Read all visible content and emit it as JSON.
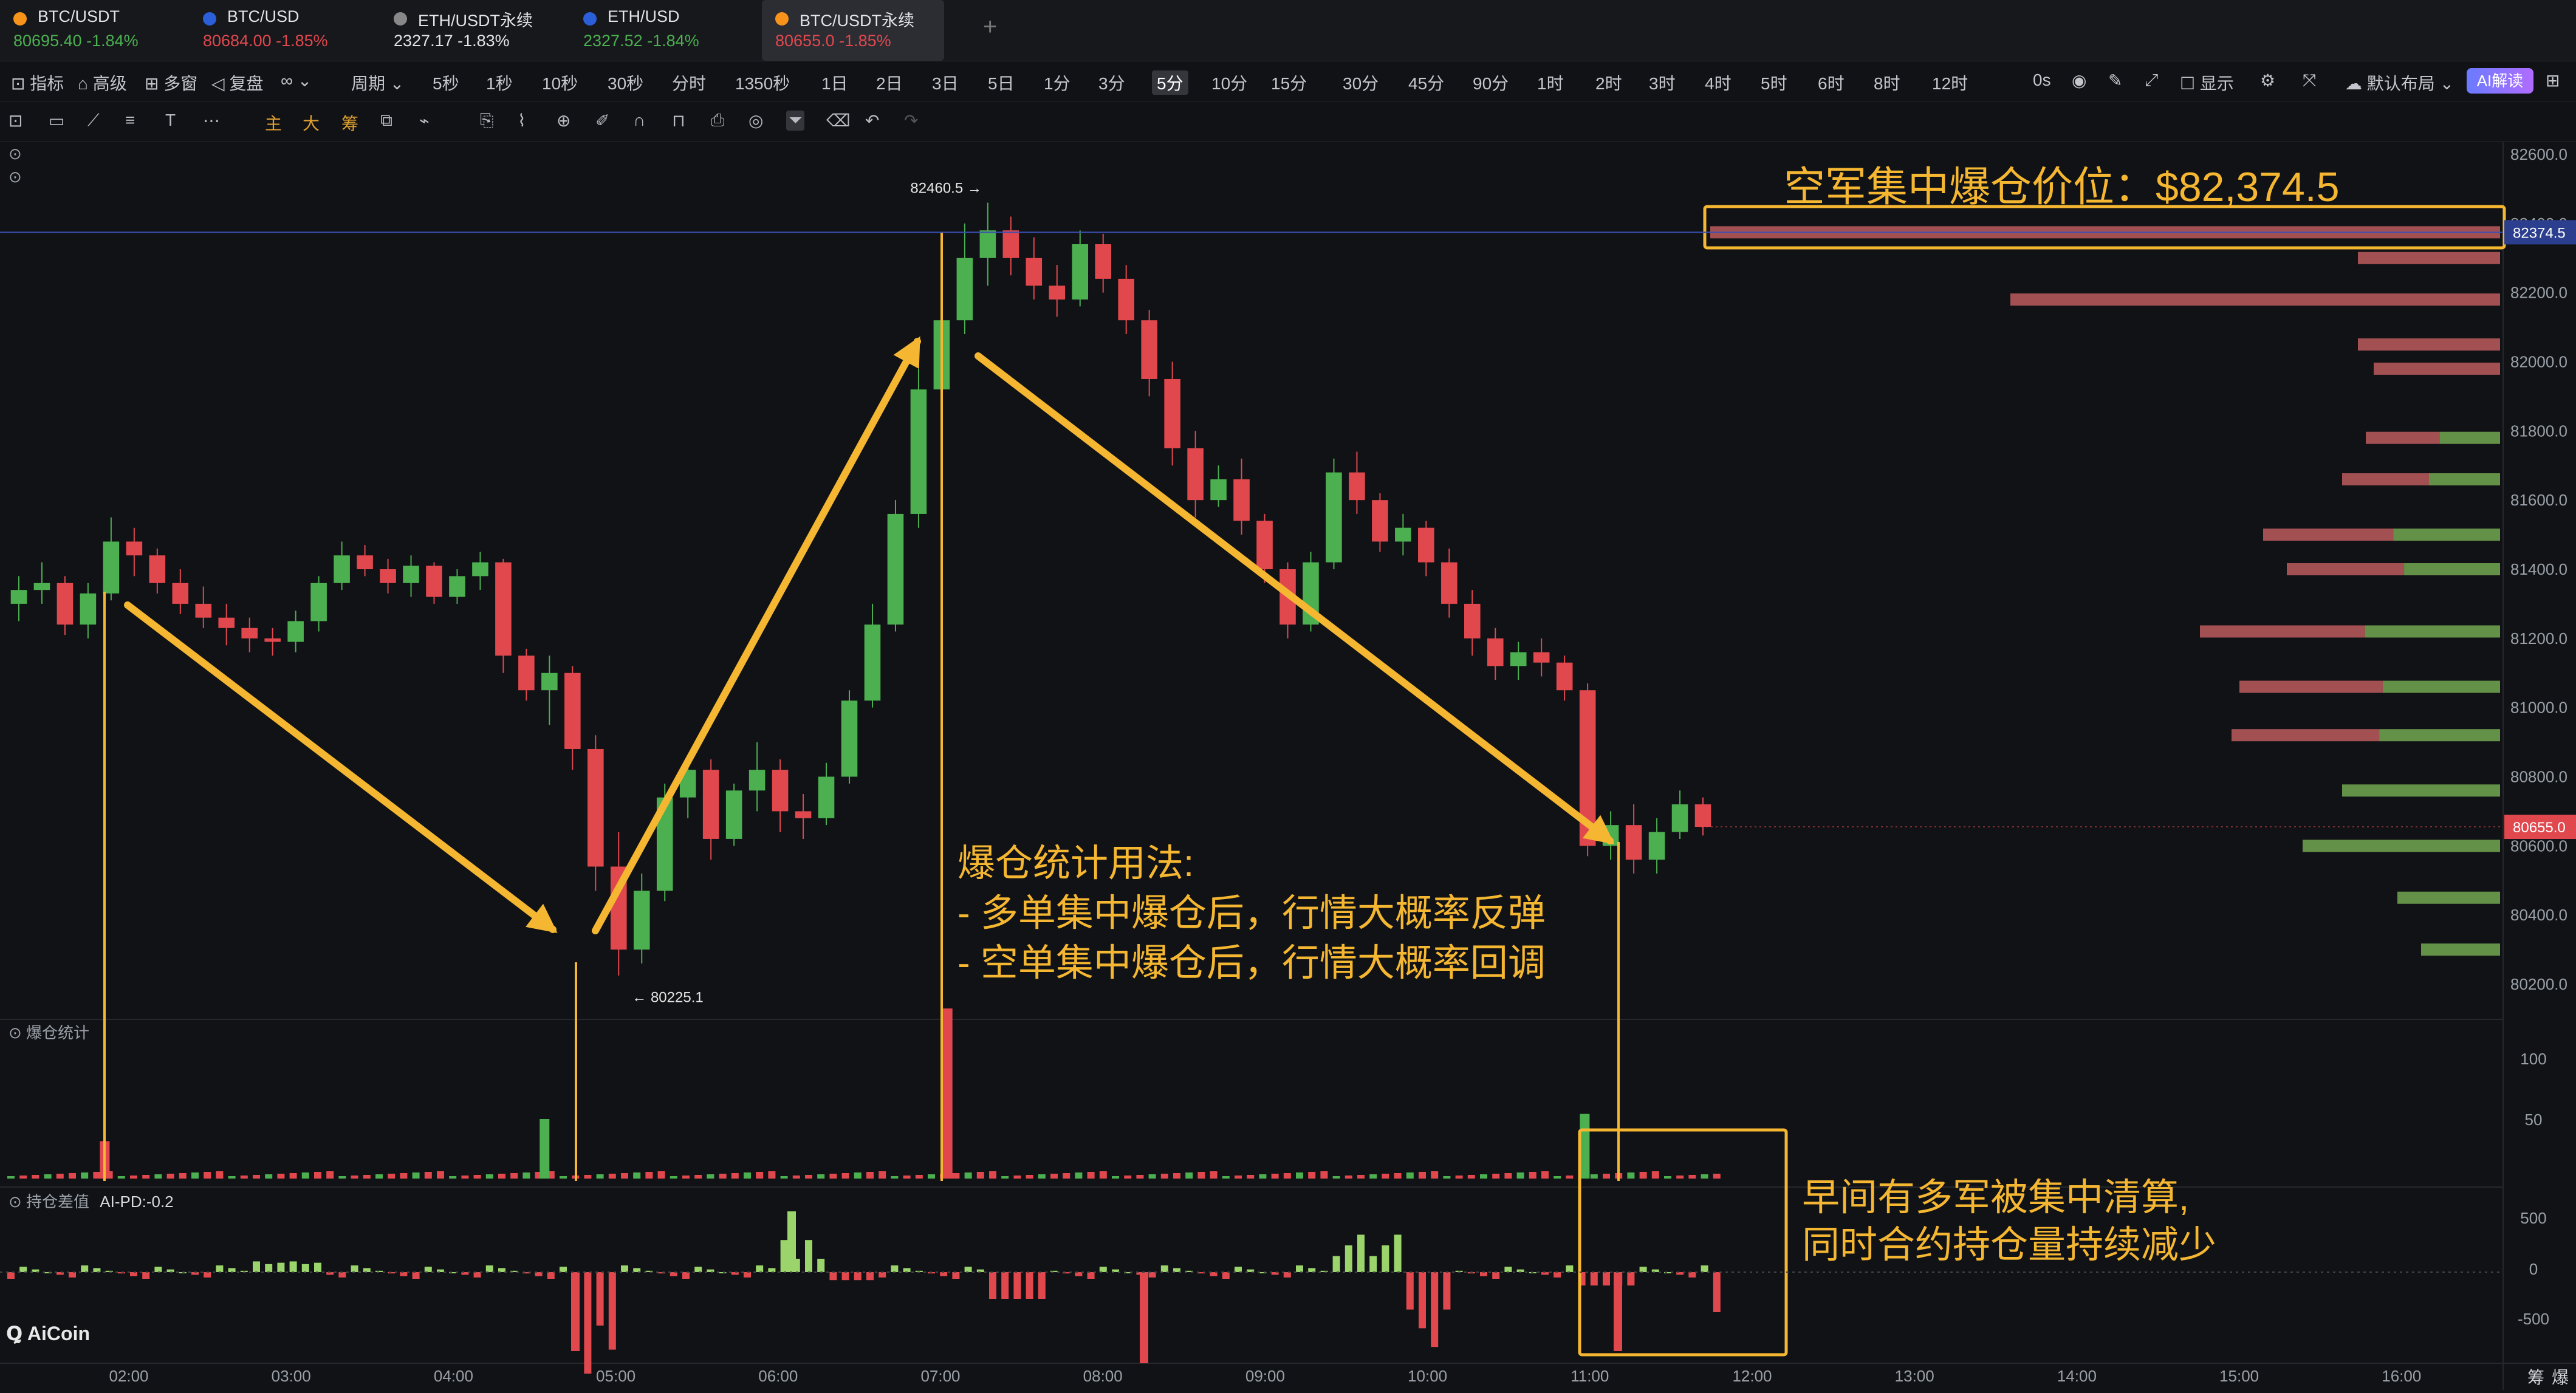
{
  "tabs": [
    {
      "name": "BTC/USDT",
      "price": "80695.40",
      "change": "-1.84%",
      "dot": "#f7931a",
      "color": "#4caf50"
    },
    {
      "name": "BTC/USD",
      "price": "80684.00",
      "change": "-1.85%",
      "dot": "#2b5fd9",
      "color": "#e0484e"
    },
    {
      "name": "ETH/USDT永续",
      "price": "2327.17",
      "change": "-1.83%",
      "dot": "#888888",
      "color": "#e2e4e8"
    },
    {
      "name": "ETH/USD",
      "price": "2327.52",
      "change": "-1.84%",
      "dot": "#2b5fd9",
      "color": "#4caf50"
    },
    {
      "name": "BTC/USDT永续",
      "price": "80655.0",
      "change": "-1.85%",
      "dot": "#f7931a",
      "color": "#e0484e"
    }
  ],
  "toolbar": {
    "indicator": "指标",
    "advanced": "高级",
    "multiwindow": "多窗",
    "replay": "复盘",
    "period": "周期",
    "intervals": [
      "5秒",
      "1秒",
      "10秒",
      "30秒",
      "分时",
      "1350秒",
      "1日",
      "2日",
      "3日",
      "5日",
      "1分",
      "3分",
      "5分",
      "10分",
      "15分",
      "30分",
      "45分",
      "90分",
      "1时",
      "2时",
      "3时",
      "4时",
      "5时",
      "6时",
      "8时",
      "12时"
    ],
    "active_interval": "5分",
    "speed": "0s",
    "display": "显示",
    "layout": "默认布局",
    "ai": "AI解读"
  },
  "toolbar2_icons": [
    "snapshot-icon",
    "rectangle-icon",
    "line-icon",
    "parallel-icon",
    "text-icon",
    "more-icon",
    "主",
    "大",
    "筹",
    "crop-icon",
    "brush-icon",
    "copy-icon",
    "ruler-icon",
    "zoom-icon",
    "pen-icon",
    "magnet-icon",
    "lock-icon",
    "screenshot-icon",
    "eye-icon",
    "filter-icon",
    "trash-icon",
    "undo-icon",
    "redo-icon"
  ],
  "price_axis": [
    "82600.0",
    "82400.0",
    "82200.0",
    "82000.0",
    "81800.0",
    "81600.0",
    "81400.0",
    "81200.0",
    "81000.0",
    "80800.0",
    "80600.0",
    "80400.0",
    "80200.0"
  ],
  "price_axis_values": [
    82600,
    82400,
    82200,
    82000,
    81800,
    81600,
    81400,
    81200,
    81000,
    80800,
    80600,
    80400,
    80200
  ],
  "current_price": "80655.0",
  "current_price_value": 80655,
  "liq_level_label": "82374.5",
  "liq_level_value": 82374.5,
  "high_label": "82460.5",
  "high_value": 82460.5,
  "low_label": "80225.1",
  "low_value": 80225.1,
  "time_axis": [
    "02:00",
    "03:00",
    "04:00",
    "05:00",
    "06:00",
    "07:00",
    "08:00",
    "09:00",
    "10:00",
    "11:00",
    "12:00",
    "13:00",
    "14:00",
    "15:00",
    "16:00"
  ],
  "liq_panel_title": "爆仓统计",
  "liq_axis": [
    "100",
    "50"
  ],
  "oi_panel_title": "持仓差值",
  "oi_indicator": "AI-PD:-0.2",
  "oi_axis": [
    "500",
    "0",
    "-500"
  ],
  "bottom_right": [
    "筹",
    "爆"
  ],
  "logo": "AiCoin",
  "annotations": {
    "top_title": "空军集中爆仓价位：$82,374.5",
    "usage_title": "爆仓统计用法:",
    "usage_line1": "- 多单集中爆仓后，行情大概率反弹",
    "usage_line2": "- 空单集中爆仓后，行情大概率回调",
    "note_line1": "早间有多军被集中清算,",
    "note_line2": "同时合约持仓量持续减少"
  },
  "colors": {
    "up": "#4caf50",
    "down": "#e0484e",
    "annotation": "#f5b731",
    "price_tag": "#e0484e",
    "level_tag": "#2c3f8f"
  },
  "chart_data": {
    "type": "candlestick",
    "interval": "5分",
    "price_range": [
      80100,
      82700
    ],
    "candles": [
      [
        81300,
        81380,
        81250,
        81340
      ],
      [
        81340,
        81420,
        81300,
        81360
      ],
      [
        81360,
        81380,
        81210,
        81240
      ],
      [
        81240,
        81360,
        81200,
        81330
      ],
      [
        81330,
        81550,
        81310,
        81480
      ],
      [
        81480,
        81520,
        81380,
        81440
      ],
      [
        81440,
        81460,
        81330,
        81360
      ],
      [
        81360,
        81400,
        81270,
        81300
      ],
      [
        81300,
        81350,
        81230,
        81260
      ],
      [
        81260,
        81300,
        81180,
        81230
      ],
      [
        81230,
        81260,
        81160,
        81200
      ],
      [
        81200,
        81230,
        81150,
        81190
      ],
      [
        81190,
        81280,
        81160,
        81250
      ],
      [
        81250,
        81380,
        81220,
        81360
      ],
      [
        81360,
        81480,
        81340,
        81440
      ],
      [
        81440,
        81470,
        81380,
        81400
      ],
      [
        81400,
        81430,
        81330,
        81360
      ],
      [
        81360,
        81440,
        81320,
        81410
      ],
      [
        81410,
        81420,
        81300,
        81320
      ],
      [
        81320,
        81400,
        81300,
        81380
      ],
      [
        81380,
        81450,
        81340,
        81420
      ],
      [
        81420,
        81430,
        81100,
        81150
      ],
      [
        81150,
        81170,
        81020,
        81050
      ],
      [
        81050,
        81150,
        80950,
        81100
      ],
      [
        81100,
        81120,
        80820,
        80880
      ],
      [
        80880,
        80920,
        80470,
        80540
      ],
      [
        80540,
        80640,
        80225,
        80300
      ],
      [
        80300,
        80520,
        80260,
        80470
      ],
      [
        80470,
        80780,
        80440,
        80740
      ],
      [
        80740,
        80860,
        80680,
        80820
      ],
      [
        80820,
        80850,
        80560,
        80620
      ],
      [
        80620,
        80780,
        80600,
        80760
      ],
      [
        80760,
        80900,
        80700,
        80820
      ],
      [
        80820,
        80850,
        80640,
        80700
      ],
      [
        80700,
        80750,
        80620,
        80680
      ],
      [
        80680,
        80840,
        80660,
        80800
      ],
      [
        80800,
        81050,
        80780,
        81020
      ],
      [
        81020,
        81300,
        81000,
        81240
      ],
      [
        81240,
        81600,
        81220,
        81560
      ],
      [
        81560,
        81980,
        81520,
        81920
      ],
      [
        81920,
        82180,
        81880,
        82120
      ],
      [
        82120,
        82400,
        82080,
        82300
      ],
      [
        82300,
        82460,
        82220,
        82380
      ],
      [
        82380,
        82420,
        82250,
        82300
      ],
      [
        82300,
        82360,
        82180,
        82220
      ],
      [
        82220,
        82280,
        82130,
        82180
      ],
      [
        82180,
        82380,
        82160,
        82340
      ],
      [
        82340,
        82370,
        82200,
        82240
      ],
      [
        82240,
        82280,
        82080,
        82120
      ],
      [
        82120,
        82150,
        81900,
        81950
      ],
      [
        81950,
        82000,
        81700,
        81750
      ],
      [
        81750,
        81800,
        81550,
        81600
      ],
      [
        81600,
        81700,
        81580,
        81660
      ],
      [
        81660,
        81720,
        81500,
        81540
      ],
      [
        81540,
        81560,
        81360,
        81400
      ],
      [
        81400,
        81420,
        81200,
        81240
      ],
      [
        81240,
        81450,
        81220,
        81420
      ],
      [
        81420,
        81720,
        81400,
        81680
      ],
      [
        81680,
        81740,
        81560,
        81600
      ],
      [
        81600,
        81620,
        81450,
        81480
      ],
      [
        81480,
        81560,
        81440,
        81520
      ],
      [
        81520,
        81540,
        81380,
        81420
      ],
      [
        81420,
        81460,
        81260,
        81300
      ],
      [
        81300,
        81340,
        81150,
        81200
      ],
      [
        81200,
        81230,
        81080,
        81120
      ],
      [
        81120,
        81190,
        81080,
        81160
      ],
      [
        81160,
        81200,
        81090,
        81130
      ],
      [
        81130,
        81150,
        81020,
        81050
      ],
      [
        81050,
        81070,
        80570,
        80600
      ],
      [
        80600,
        80700,
        80560,
        80660
      ],
      [
        80660,
        80720,
        80520,
        80560
      ],
      [
        80560,
        80680,
        80520,
        80640
      ],
      [
        80640,
        80760,
        80620,
        80720
      ],
      [
        80720,
        80740,
        80630,
        80655
      ]
    ],
    "liquidations": [
      {
        "x": 0.04,
        "v": 22,
        "side": "long"
      },
      {
        "x": 0.23,
        "v": 35,
        "side": "long"
      },
      {
        "x": 0.37,
        "v": 100,
        "side": "short"
      },
      {
        "x": 0.64,
        "v": 38,
        "side": "long"
      }
    ],
    "volume_profile_levels": [
      {
        "price": 82374.5,
        "size": 1.0,
        "color": "down"
      },
      {
        "price": 82300,
        "size": 0.18,
        "color": "down"
      },
      {
        "price": 82180,
        "size": 0.62,
        "color": "down"
      },
      {
        "price": 82050,
        "size": 0.18,
        "color": "down"
      },
      {
        "price": 81980,
        "size": 0.16,
        "color": "down"
      },
      {
        "price": 81780,
        "size": 0.17,
        "color": "mix"
      },
      {
        "price": 81660,
        "size": 0.2,
        "color": "mix"
      },
      {
        "price": 81500,
        "size": 0.3,
        "color": "mix"
      },
      {
        "price": 81400,
        "size": 0.27,
        "color": "mix"
      },
      {
        "price": 81220,
        "size": 0.38,
        "color": "mix"
      },
      {
        "price": 81060,
        "size": 0.33,
        "color": "mix"
      },
      {
        "price": 80920,
        "size": 0.34,
        "color": "mix"
      },
      {
        "price": 80760,
        "size": 0.2,
        "color": "up"
      },
      {
        "price": 80600,
        "size": 0.25,
        "color": "up"
      },
      {
        "price": 80450,
        "size": 0.13,
        "color": "up"
      },
      {
        "price": 80300,
        "size": 0.1,
        "color": "up"
      }
    ]
  }
}
